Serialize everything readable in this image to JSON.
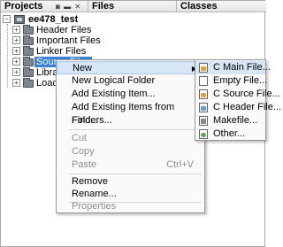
{
  "header": {
    "tabs": [
      "Projects",
      "Files",
      "Classes"
    ],
    "icons": [
      "tab-list-icon",
      "minimize-icon"
    ]
  },
  "tree": {
    "project": "ee478_test",
    "folders": [
      {
        "label": "Header Files",
        "icon": "folder-icon"
      },
      {
        "label": "Important Files",
        "icon": "folder-icon"
      },
      {
        "label": "Linker Files",
        "icon": "folder-icon"
      },
      {
        "label": "Source Files",
        "icon": "folder-icon",
        "selected": true
      },
      {
        "label": "Librar",
        "icon": "folder-icon"
      },
      {
        "label": "Loadab",
        "icon": "folder-icon"
      }
    ]
  },
  "context_menu": {
    "items": [
      {
        "label": "New",
        "submenu": true
      },
      {
        "label": "New Logical Folder"
      },
      {
        "label": "Add Existing Item..."
      },
      {
        "label": "Add Existing Items from Folders..."
      },
      {
        "label": "Find..."
      },
      {
        "label": "Cut",
        "disabled": true
      },
      {
        "label": "Copy",
        "disabled": true
      },
      {
        "label": "Paste",
        "disabled": true,
        "shortcut": "Ctrl+V"
      },
      {
        "label": "Remove"
      },
      {
        "label": "Rename..."
      },
      {
        "label": "Properties",
        "disabled": true
      }
    ]
  },
  "submenu": {
    "items": [
      {
        "label": "C Main File...",
        "icon": "c-main-file-icon"
      },
      {
        "label": "Empty File...",
        "icon": "empty-file-icon"
      },
      {
        "label": "C Source File...",
        "icon": "c-source-file-icon"
      },
      {
        "label": "C Header File...",
        "icon": "c-header-file-icon"
      },
      {
        "label": "Makefile...",
        "icon": "makefile-icon"
      },
      {
        "label": "Other...",
        "icon": "other-file-icon"
      }
    ]
  },
  "colors": {
    "selection": "#3a80d8",
    "menu_hover": "#d7e6f7"
  }
}
